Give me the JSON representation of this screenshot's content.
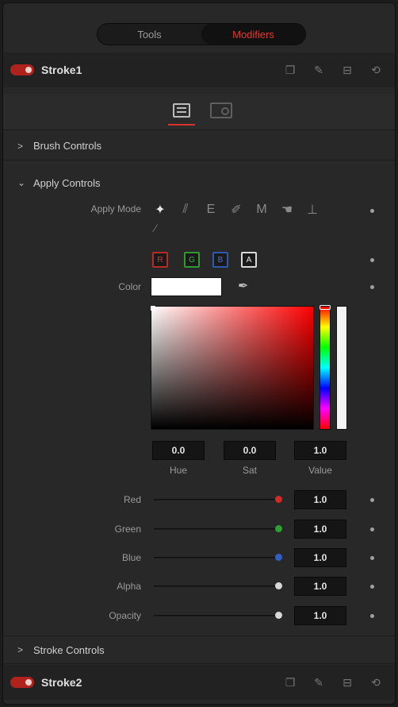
{
  "tabs": [
    {
      "label": "Tools",
      "active": false
    },
    {
      "label": "Modifiers",
      "active": true
    }
  ],
  "nodes": {
    "top": {
      "name": "Stroke1",
      "enabled": true
    },
    "bottom": {
      "name": "Stroke2",
      "enabled": true
    }
  },
  "node_icons": [
    "window-icon",
    "pin-icon",
    "lock-icon",
    "reset-icon"
  ],
  "view_icons": [
    "controls-view-icon",
    "modifiers-view-icon"
  ],
  "sections": {
    "brush": "Brush Controls",
    "apply": "Apply Controls",
    "stroke": "Stroke Controls"
  },
  "apply_mode": {
    "label": "Apply Mode",
    "modes": [
      "color-mode-icon",
      "clone-mode-icon",
      "emboss-mode-icon",
      "erase-mode-icon",
      "merge-mode-icon",
      "smear-mode-icon",
      "stamp-mode-icon",
      "wire-mode-icon"
    ],
    "selected": "color-mode-icon"
  },
  "channels": [
    {
      "key": "R",
      "color": "#b82a24"
    },
    {
      "key": "G",
      "color": "#2f9a2f"
    },
    {
      "key": "B",
      "color": "#2f58b0"
    },
    {
      "key": "A",
      "color": "#d8d8d8"
    }
  ],
  "color": {
    "label": "Color",
    "swatch": "#ffffff",
    "hue": "0.0",
    "sat": "0.0",
    "value": "1.0",
    "hue_label": "Hue",
    "sat_label": "Sat",
    "value_label": "Value"
  },
  "sliders": [
    {
      "label": "Red",
      "value": "1.0",
      "knob_color": "#d22a22",
      "fraction": 1.0
    },
    {
      "label": "Green",
      "value": "1.0",
      "knob_color": "#2da02d",
      "fraction": 1.0
    },
    {
      "label": "Blue",
      "value": "1.0",
      "knob_color": "#2f5fc6",
      "fraction": 1.0
    },
    {
      "label": "Alpha",
      "value": "1.0",
      "knob_color": "#d8d8d8",
      "fraction": 1.0
    },
    {
      "label": "Opacity",
      "value": "1.0",
      "knob_color": "#d8d8d8",
      "fraction": 1.0
    }
  ]
}
